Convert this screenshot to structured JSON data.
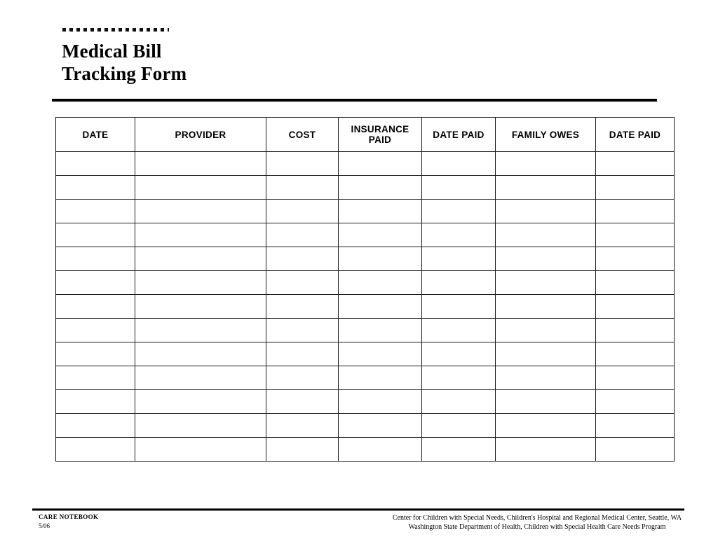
{
  "document": {
    "title": "Medical Bill\nTracking Form",
    "decorative_rule": "dotted-square-rule"
  },
  "table": {
    "columns": [
      {
        "key": "date",
        "label": "DATE"
      },
      {
        "key": "provider",
        "label": "PROVIDER"
      },
      {
        "key": "cost",
        "label": "COST"
      },
      {
        "key": "insurance_paid",
        "label": "INSURANCE\nPAID"
      },
      {
        "key": "date_paid_insurance",
        "label": "DATE PAID"
      },
      {
        "key": "family_owes",
        "label": "FAMILY OWES"
      },
      {
        "key": "date_paid_family",
        "label": "DATE PAID"
      }
    ],
    "row_count": 13,
    "rows": [
      [
        "",
        "",
        "",
        "",
        "",
        "",
        ""
      ],
      [
        "",
        "",
        "",
        "",
        "",
        "",
        ""
      ],
      [
        "",
        "",
        "",
        "",
        "",
        "",
        ""
      ],
      [
        "",
        "",
        "",
        "",
        "",
        "",
        ""
      ],
      [
        "",
        "",
        "",
        "",
        "",
        "",
        ""
      ],
      [
        "",
        "",
        "",
        "",
        "",
        "",
        ""
      ],
      [
        "",
        "",
        "",
        "",
        "",
        "",
        ""
      ],
      [
        "",
        "",
        "",
        "",
        "",
        "",
        ""
      ],
      [
        "",
        "",
        "",
        "",
        "",
        "",
        ""
      ],
      [
        "",
        "",
        "",
        "",
        "",
        "",
        ""
      ],
      [
        "",
        "",
        "",
        "",
        "",
        "",
        ""
      ],
      [
        "",
        "",
        "",
        "",
        "",
        "",
        ""
      ],
      [
        "",
        "",
        "",
        "",
        "",
        "",
        ""
      ]
    ]
  },
  "footer": {
    "brand": "CARE NOTEBOOK",
    "revision": "5/06",
    "credit_line_1": "Center for Children with Special Needs, Children's Hospital and Regional Medical Center, Seattle, WA",
    "credit_line_2": "Washington State Department of Health, Children with Special Health Care Needs Program"
  },
  "colors": {
    "ink": "#000000",
    "rule": "#1b1b1b",
    "paper": "#ffffff"
  }
}
